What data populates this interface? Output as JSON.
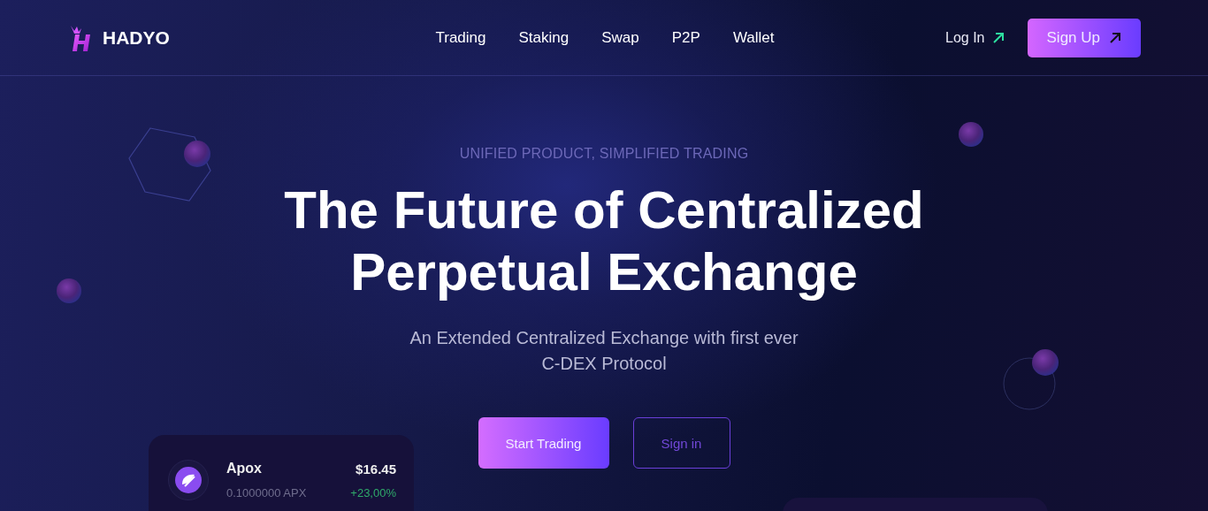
{
  "brand": {
    "name": "HADYO"
  },
  "nav": [
    {
      "label": "Trading"
    },
    {
      "label": "Staking"
    },
    {
      "label": "Swap"
    },
    {
      "label": "P2P"
    },
    {
      "label": "Wallet"
    }
  ],
  "auth": {
    "login": "Log In",
    "signup": "Sign Up"
  },
  "hero": {
    "eyebrow": "UNIFIED PRODUCT, SIMPLIFIED TRADING",
    "headline_lines": [
      "The Future of Centralized",
      "Perpetual Exchange"
    ],
    "subtitle_lines": [
      "An Extended Centralized Exchange with first ever",
      "C-DEX Protocol"
    ],
    "buttons": [
      {
        "label": "Start Trading",
        "kind": "primary"
      },
      {
        "label": "Sign in",
        "kind": "outline"
      }
    ]
  },
  "token_card": {
    "name": "Apox",
    "amount": "0.1000000 APX",
    "price": "$16.45",
    "change": "+23,00%"
  }
}
